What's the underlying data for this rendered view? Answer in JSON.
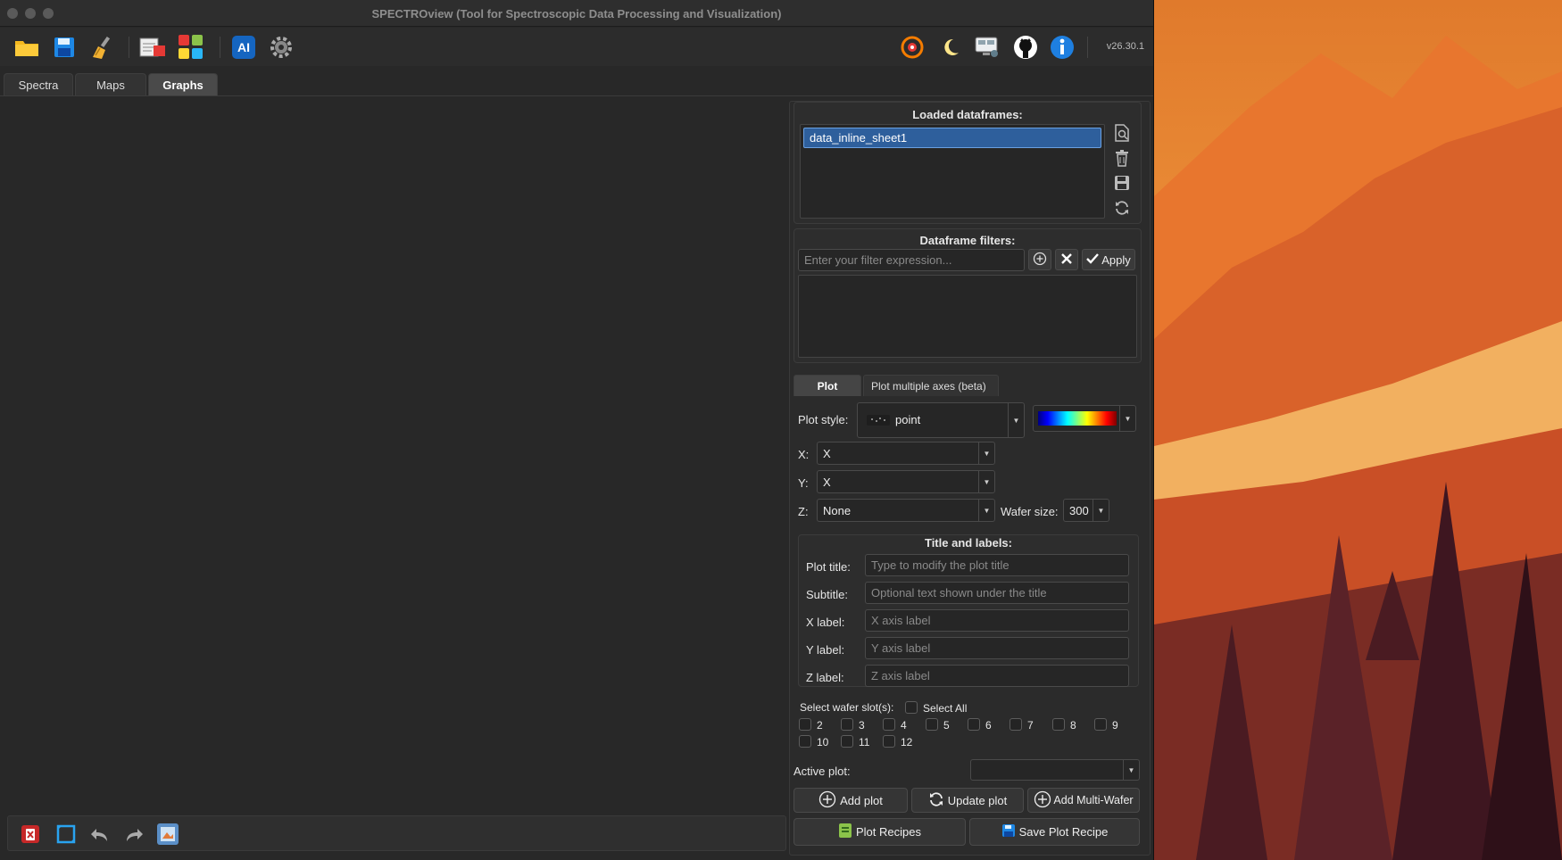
{
  "window": {
    "title": "SPECTROview (Tool for Spectroscopic Data Processing and Visualization)",
    "version": "v26.30.1"
  },
  "toolbar": {
    "left_icons": [
      "open-folder-icon",
      "save-icon",
      "clear-broom-icon",
      "convert-file-icon",
      "apps-grid-icon",
      "ai-icon",
      "settings-gear-icon"
    ],
    "right_icons": [
      "update-cycle-icon",
      "dark-mode-moon-icon",
      "manual-monitor-icon",
      "github-icon",
      "info-icon"
    ]
  },
  "tabs": [
    {
      "label": "Spectra",
      "active": false
    },
    {
      "label": "Maps",
      "active": false
    },
    {
      "label": "Graphs",
      "active": true
    }
  ],
  "dataframes": {
    "heading": "Loaded dataframes:",
    "items": [
      "data_inline_sheet1"
    ]
  },
  "filters": {
    "heading": "Dataframe filters:",
    "placeholder": "Enter your filter expression...",
    "apply_label": "Apply"
  },
  "plot_tabs": [
    {
      "label": "Plot",
      "active": true
    },
    {
      "label": "Plot multiple axes (beta)",
      "active": false
    }
  ],
  "plot": {
    "style_label": "Plot style:",
    "style_value": "point",
    "x_label": "X:",
    "x_value": "X",
    "y_label": "Y:",
    "y_value": "X",
    "z_label": "Z:",
    "z_value": "None",
    "wafer_size_label": "Wafer size:",
    "wafer_size_value": "300"
  },
  "titles": {
    "heading": "Title and labels:",
    "plot_title_label": "Plot title:",
    "plot_title_placeholder": "Type to modify the plot title",
    "subtitle_label": "Subtitle:",
    "subtitle_placeholder": "Optional text shown under the title",
    "xlabel_label": "X label:",
    "xlabel_placeholder": "X axis label",
    "ylabel_label": "Y label:",
    "ylabel_placeholder": "Y axis label",
    "zlabel_label": "Z label:",
    "zlabel_placeholder": "Z axis label"
  },
  "wafer": {
    "select_label": "Select wafer slot(s):",
    "select_all_label": "Select All",
    "slots": [
      "2",
      "3",
      "4",
      "5",
      "6",
      "7",
      "8",
      "9",
      "10",
      "11",
      "12"
    ]
  },
  "active_plot": {
    "label": "Active plot:",
    "value": ""
  },
  "buttons": {
    "add_plot": "Add plot",
    "update_plot": "Update plot",
    "add_multi_wafer": "Add Multi-Wafer",
    "plot_recipes": "Plot Recipes",
    "save_plot_recipe": "Save Plot Recipe"
  },
  "colors": {
    "accent_selection": "#2e5f9c",
    "window_bg": "#282828",
    "info_blue": "#1e7fe0"
  }
}
